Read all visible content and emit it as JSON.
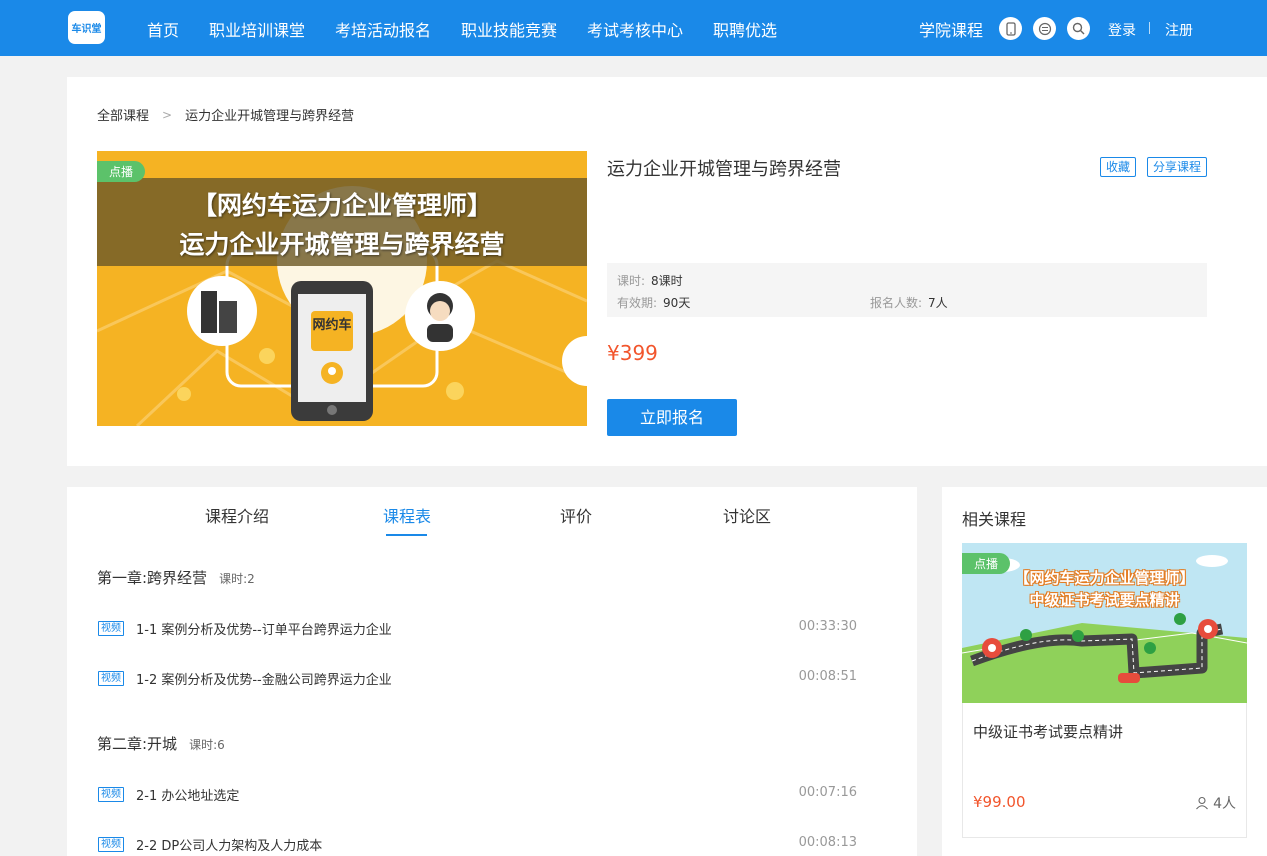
{
  "header": {
    "logo_text": "车识堂",
    "nav": [
      "首页",
      "职业培训课堂",
      "考培活动报名",
      "职业技能竞赛",
      "考试考核中心",
      "职聘优选"
    ],
    "academy_link": "学院课程",
    "icons": [
      "mobile-icon",
      "mini-program-icon",
      "search-icon"
    ],
    "login": "登录",
    "register": "注册"
  },
  "breadcrumb": {
    "root": "全部课程",
    "current": "运力企业开城管理与跨界经营"
  },
  "course": {
    "badge": "点播",
    "cover_line1": "【网约车运力企业管理师】",
    "cover_line2": "运力企业开城管理与跨界经营",
    "phone_label": "网约车",
    "title": "运力企业开城管理与跨界经营",
    "favorite": "收藏",
    "share": "分享课程",
    "hours_label": "课时:",
    "hours_value": "8课时",
    "validity_label": "有效期:",
    "validity_value": "90天",
    "enrolled_label": "报名人数:",
    "enrolled_value": "7人",
    "price": "¥399",
    "enroll_button": "立即报名"
  },
  "tabs": [
    "课程介绍",
    "课程表",
    "评价",
    "讨论区"
  ],
  "active_tab": "课程表",
  "chapters": [
    {
      "title": "第一章:跨界经营",
      "hours": "课时:2",
      "lessons": [
        {
          "tag": "视频",
          "title": "1-1 案例分析及优势--订单平台跨界运力企业",
          "duration": "00:33:30"
        },
        {
          "tag": "视频",
          "title": "1-2 案例分析及优势--金融公司跨界运力企业",
          "duration": "00:08:51"
        }
      ]
    },
    {
      "title": "第二章:开城",
      "hours": "课时:6",
      "lessons": [
        {
          "tag": "视频",
          "title": "2-1 办公地址选定",
          "duration": "00:07:16"
        },
        {
          "tag": "视频",
          "title": "2-2 DP公司人力架构及人力成本",
          "duration": "00:08:13"
        }
      ]
    }
  ],
  "related": {
    "title": "相关课程",
    "badge": "点播",
    "cover_line1": "【网约车运力企业管理师】",
    "cover_line2": "中级证书考试要点精讲",
    "name": "中级证书考试要点精讲",
    "price": "¥99.00",
    "count": "4人"
  },
  "colors": {
    "primary": "#1a89e8",
    "price": "#f2552c",
    "live_badge": "#5cc26a"
  }
}
